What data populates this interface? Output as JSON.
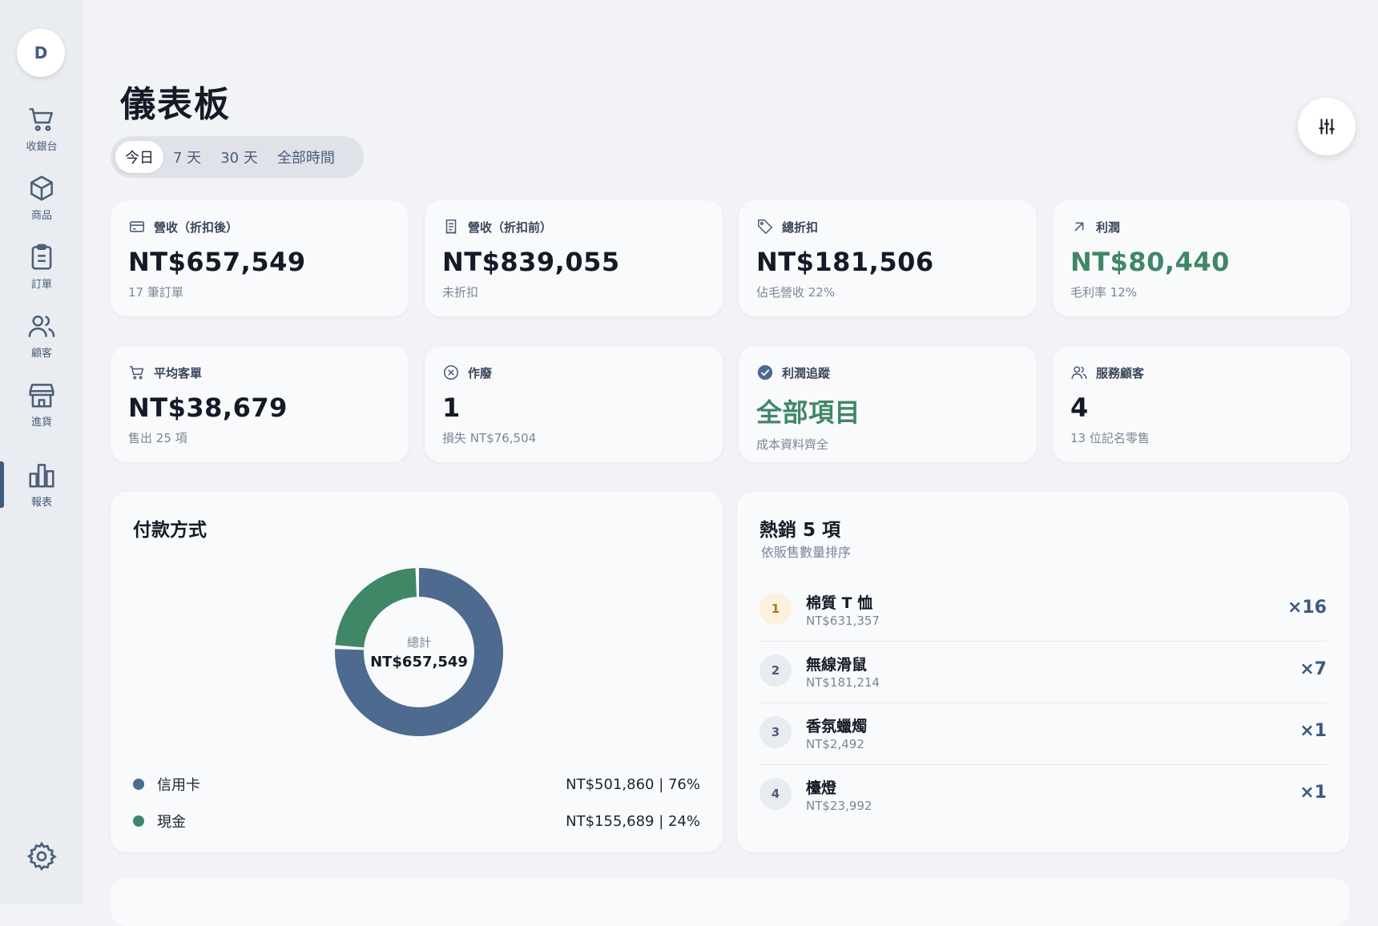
{
  "user": {
    "initial": "D"
  },
  "nav": [
    {
      "label": "收銀台",
      "icon": "cart-icon"
    },
    {
      "label": "商品",
      "icon": "box-icon"
    },
    {
      "label": "訂單",
      "icon": "clipboard-icon"
    },
    {
      "label": "顧客",
      "icon": "users-icon"
    },
    {
      "label": "進貨",
      "icon": "store-icon"
    },
    {
      "label": "報表",
      "icon": "bar-chart-icon",
      "active": true
    }
  ],
  "page": {
    "title": "儀表板"
  },
  "ranges": [
    "今日",
    "7 天",
    "30 天",
    "全部時間"
  ],
  "active_range": "今日",
  "stats": [
    {
      "label": "營收（折扣後）",
      "value": "NT$657,549",
      "sub": "17 筆訂單",
      "icon": "credit-card-icon"
    },
    {
      "label": "營收（折扣前）",
      "value": "NT$839,055",
      "sub": "未折扣",
      "icon": "receipt-icon"
    },
    {
      "label": "總折扣",
      "value": "NT$181,506",
      "sub": "佔毛營收 22%",
      "icon": "tag-icon"
    },
    {
      "label": "利潤",
      "value": "NT$80,440",
      "sub": "毛利率 12%",
      "icon": "arrow-up-right-icon",
      "color": "#3f8766"
    },
    {
      "label": "平均客單",
      "value": "NT$38,679",
      "sub": "售出 25 項",
      "icon": "cart-icon"
    },
    {
      "label": "作廢",
      "value": "1",
      "sub": "損失 NT$76,504",
      "icon": "x-circle-icon"
    },
    {
      "label": "利潤追蹤",
      "value": "全部項目",
      "sub": "成本資料齊全",
      "icon": "check-circle-icon",
      "color": "#3f8766"
    },
    {
      "label": "服務顧客",
      "value": "4",
      "sub": "13 位記名零售",
      "icon": "users-icon"
    }
  ],
  "payment": {
    "title": "付款方式",
    "total_label": "總計",
    "total_value": "NT$657,549",
    "methods": [
      {
        "name": "信用卡",
        "amount": "NT$501,860 | 76%",
        "share": 76.3,
        "color": "#4f6a8f"
      },
      {
        "name": "現金",
        "amount": "NT$155,689 | 24%",
        "share": 23.7,
        "color": "#3f8766"
      }
    ]
  },
  "top_sellers": {
    "title": "熱銷 5 項",
    "subtitle": "依販售數量排序",
    "items": [
      {
        "rank": "1",
        "name": "棉質 T 恤",
        "revenue": "NT$631,357",
        "qty": "×16"
      },
      {
        "rank": "2",
        "name": "無線滑鼠",
        "revenue": "NT$181,214",
        "qty": "×7"
      },
      {
        "rank": "3",
        "name": "香氛蠟燭",
        "revenue": "NT$2,492",
        "qty": "×1"
      },
      {
        "rank": "4",
        "name": "檯燈",
        "revenue": "NT$23,992",
        "qty": "×1"
      }
    ]
  }
}
